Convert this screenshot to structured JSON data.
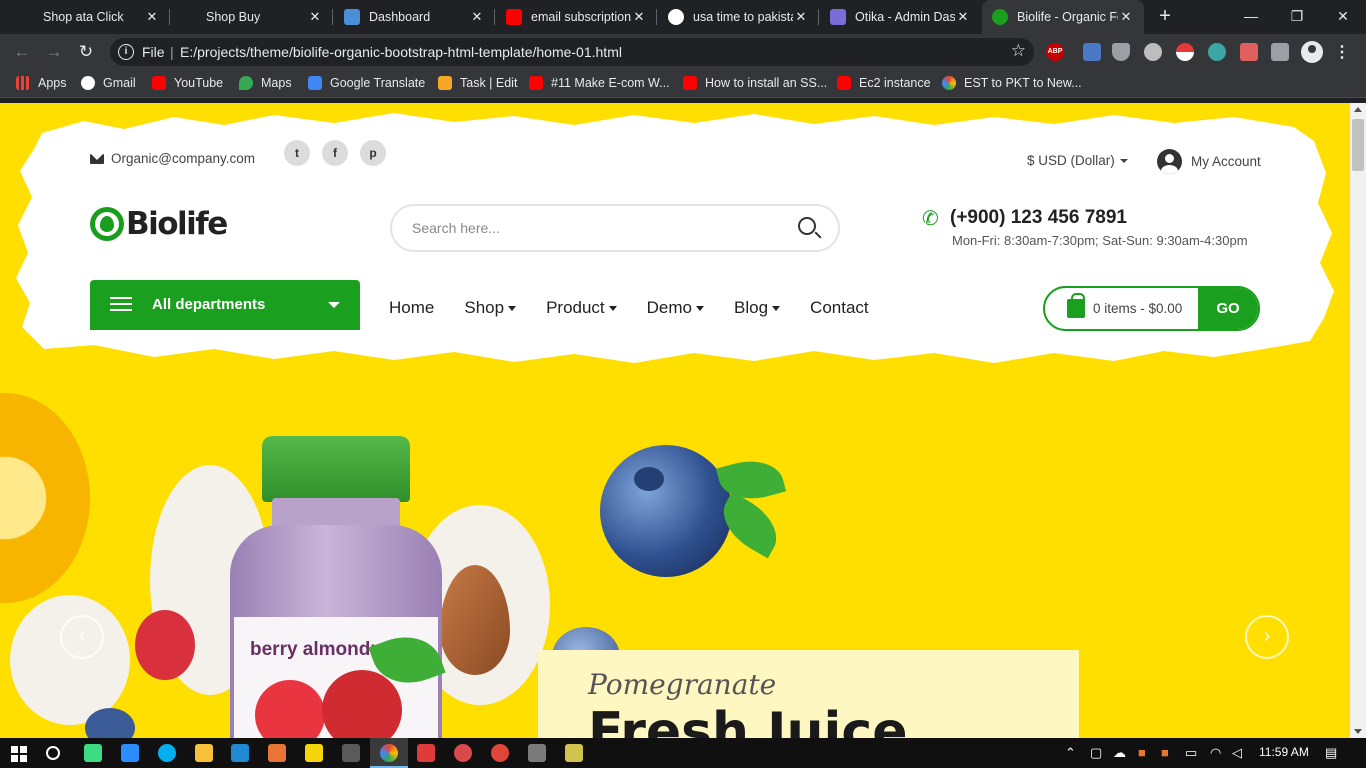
{
  "browser": {
    "tabs": [
      {
        "label": "Shop ata Click",
        "color": "#202124",
        "active": false
      },
      {
        "label": "Shop Buy",
        "color": "#202124",
        "active": false
      },
      {
        "label": "Dashboard",
        "color": "#4a90d9",
        "active": false
      },
      {
        "label": "email subscription",
        "color": "#ff0000",
        "active": false
      },
      {
        "label": "usa time to pakista",
        "color": "#ffffff",
        "active": false
      },
      {
        "label": "Otika - Admin Das",
        "color": "#7c6cd8",
        "active": false
      },
      {
        "label": "Biolife - Organic Fo",
        "color": "#1a9f1e",
        "active": true
      }
    ],
    "new_tab": "+",
    "address": {
      "scheme": "File",
      "url": "E:/projects/theme/biolife-organic-bootstrap-html-template/home-01.html"
    },
    "extensions": [
      {
        "name": "adblock-icon",
        "text": "ABP",
        "color": "#c60000"
      },
      {
        "name": "translate-ext-icon",
        "text": "",
        "color": "#4a78c2"
      },
      {
        "name": "shield-ext-icon",
        "text": "",
        "color": "#9aa0a6"
      },
      {
        "name": "circle-ext-icon",
        "text": "",
        "color": "#bdbdbd"
      },
      {
        "name": "pokeball-ext-icon",
        "text": "",
        "color": "#e53935"
      },
      {
        "name": "hex-ext-icon",
        "text": "",
        "color": "#3aa6a6"
      },
      {
        "name": "video-ext-icon",
        "text": "",
        "color": "#e06060"
      },
      {
        "name": "puzzle-icon",
        "text": "",
        "color": "#9aa0a6"
      }
    ],
    "bookmarks": [
      {
        "label": "Apps",
        "color": "#ea4335"
      },
      {
        "label": "Gmail",
        "color": "#ffffff"
      },
      {
        "label": "YouTube",
        "color": "#ff0000"
      },
      {
        "label": "Maps",
        "color": "#34a853"
      },
      {
        "label": "Google Translate",
        "color": "#4285f4"
      },
      {
        "label": "Task | Edit",
        "color": "#f5a623"
      },
      {
        "label": "#11 Make E-com W...",
        "color": "#ff0000"
      },
      {
        "label": "How to install an SS...",
        "color": "#ff0000"
      },
      {
        "label": "Ec2 instance",
        "color": "#ff0000"
      },
      {
        "label": "EST to PKT to New...",
        "color": "#4285f4"
      }
    ]
  },
  "site": {
    "email": "Organic@company.com",
    "social": [
      "twitter",
      "facebook",
      "pinterest"
    ],
    "currency": "$ USD (Dollar)",
    "account": "My Account",
    "logo": "Biolife",
    "search_placeholder": "Search here...",
    "phone": "(+900) 123 456 7891",
    "hours": "Mon-Fri: 8:30am-7:30pm; Sat-Sun: 9:30am-4:30pm",
    "departments": "All departments",
    "nav": [
      {
        "label": "Home",
        "dropdown": false
      },
      {
        "label": "Shop",
        "dropdown": true
      },
      {
        "label": "Product",
        "dropdown": true
      },
      {
        "label": "Demo",
        "dropdown": true
      },
      {
        "label": "Blog",
        "dropdown": true
      },
      {
        "label": "Contact",
        "dropdown": false
      }
    ],
    "cart": "0 items - $0.00",
    "cart_go": "GO",
    "hero": {
      "product_text": "berry almondmilk",
      "subtitle": "Pomegranate",
      "title": "Fresh Juice"
    },
    "brand_color": "#1a9f1e",
    "page_bg": "#ffdf00"
  },
  "taskbar": {
    "time": "11:59 AM"
  }
}
